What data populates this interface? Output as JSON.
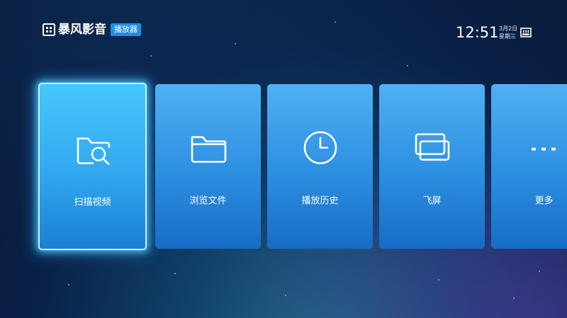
{
  "header": {
    "brand_name": "暴风影音",
    "brand_badge": "播放器",
    "time": "12:51",
    "date": "3月2日",
    "weekday": "星期三"
  },
  "icons": {
    "logo": "logo-mark-icon",
    "network": "ethernet-icon"
  },
  "menu": {
    "items": [
      {
        "label": "扫描视频",
        "icon": "folder-search-icon",
        "selected": true
      },
      {
        "label": "浏览文件",
        "icon": "folder-icon",
        "selected": false
      },
      {
        "label": "播放历史",
        "icon": "clock-icon",
        "selected": false
      },
      {
        "label": "飞屏",
        "icon": "screen-cast-icon",
        "selected": false
      },
      {
        "label": "更多",
        "icon": "more-dots-icon",
        "selected": false
      }
    ]
  },
  "colors": {
    "background": "#0a2248",
    "card": "#2c8ee0",
    "card_selected": "#31a7ef",
    "badge": "#1f8fe0"
  }
}
